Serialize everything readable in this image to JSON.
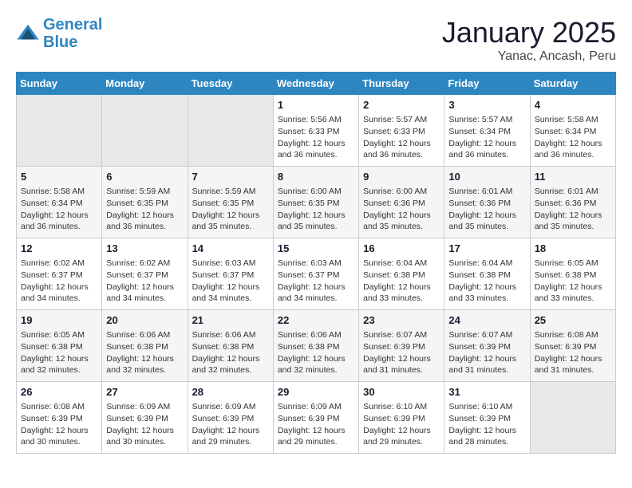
{
  "header": {
    "logo_line1": "General",
    "logo_line2": "Blue",
    "title": "January 2025",
    "subtitle": "Yanac, Ancash, Peru"
  },
  "weekdays": [
    "Sunday",
    "Monday",
    "Tuesday",
    "Wednesday",
    "Thursday",
    "Friday",
    "Saturday"
  ],
  "weeks": [
    [
      {
        "day": "",
        "info": ""
      },
      {
        "day": "",
        "info": ""
      },
      {
        "day": "",
        "info": ""
      },
      {
        "day": "1",
        "info": "Sunrise: 5:56 AM\nSunset: 6:33 PM\nDaylight: 12 hours\nand 36 minutes."
      },
      {
        "day": "2",
        "info": "Sunrise: 5:57 AM\nSunset: 6:33 PM\nDaylight: 12 hours\nand 36 minutes."
      },
      {
        "day": "3",
        "info": "Sunrise: 5:57 AM\nSunset: 6:34 PM\nDaylight: 12 hours\nand 36 minutes."
      },
      {
        "day": "4",
        "info": "Sunrise: 5:58 AM\nSunset: 6:34 PM\nDaylight: 12 hours\nand 36 minutes."
      }
    ],
    [
      {
        "day": "5",
        "info": "Sunrise: 5:58 AM\nSunset: 6:34 PM\nDaylight: 12 hours\nand 36 minutes."
      },
      {
        "day": "6",
        "info": "Sunrise: 5:59 AM\nSunset: 6:35 PM\nDaylight: 12 hours\nand 36 minutes."
      },
      {
        "day": "7",
        "info": "Sunrise: 5:59 AM\nSunset: 6:35 PM\nDaylight: 12 hours\nand 35 minutes."
      },
      {
        "day": "8",
        "info": "Sunrise: 6:00 AM\nSunset: 6:35 PM\nDaylight: 12 hours\nand 35 minutes."
      },
      {
        "day": "9",
        "info": "Sunrise: 6:00 AM\nSunset: 6:36 PM\nDaylight: 12 hours\nand 35 minutes."
      },
      {
        "day": "10",
        "info": "Sunrise: 6:01 AM\nSunset: 6:36 PM\nDaylight: 12 hours\nand 35 minutes."
      },
      {
        "day": "11",
        "info": "Sunrise: 6:01 AM\nSunset: 6:36 PM\nDaylight: 12 hours\nand 35 minutes."
      }
    ],
    [
      {
        "day": "12",
        "info": "Sunrise: 6:02 AM\nSunset: 6:37 PM\nDaylight: 12 hours\nand 34 minutes."
      },
      {
        "day": "13",
        "info": "Sunrise: 6:02 AM\nSunset: 6:37 PM\nDaylight: 12 hours\nand 34 minutes."
      },
      {
        "day": "14",
        "info": "Sunrise: 6:03 AM\nSunset: 6:37 PM\nDaylight: 12 hours\nand 34 minutes."
      },
      {
        "day": "15",
        "info": "Sunrise: 6:03 AM\nSunset: 6:37 PM\nDaylight: 12 hours\nand 34 minutes."
      },
      {
        "day": "16",
        "info": "Sunrise: 6:04 AM\nSunset: 6:38 PM\nDaylight: 12 hours\nand 33 minutes."
      },
      {
        "day": "17",
        "info": "Sunrise: 6:04 AM\nSunset: 6:38 PM\nDaylight: 12 hours\nand 33 minutes."
      },
      {
        "day": "18",
        "info": "Sunrise: 6:05 AM\nSunset: 6:38 PM\nDaylight: 12 hours\nand 33 minutes."
      }
    ],
    [
      {
        "day": "19",
        "info": "Sunrise: 6:05 AM\nSunset: 6:38 PM\nDaylight: 12 hours\nand 32 minutes."
      },
      {
        "day": "20",
        "info": "Sunrise: 6:06 AM\nSunset: 6:38 PM\nDaylight: 12 hours\nand 32 minutes."
      },
      {
        "day": "21",
        "info": "Sunrise: 6:06 AM\nSunset: 6:38 PM\nDaylight: 12 hours\nand 32 minutes."
      },
      {
        "day": "22",
        "info": "Sunrise: 6:06 AM\nSunset: 6:38 PM\nDaylight: 12 hours\nand 32 minutes."
      },
      {
        "day": "23",
        "info": "Sunrise: 6:07 AM\nSunset: 6:39 PM\nDaylight: 12 hours\nand 31 minutes."
      },
      {
        "day": "24",
        "info": "Sunrise: 6:07 AM\nSunset: 6:39 PM\nDaylight: 12 hours\nand 31 minutes."
      },
      {
        "day": "25",
        "info": "Sunrise: 6:08 AM\nSunset: 6:39 PM\nDaylight: 12 hours\nand 31 minutes."
      }
    ],
    [
      {
        "day": "26",
        "info": "Sunrise: 6:08 AM\nSunset: 6:39 PM\nDaylight: 12 hours\nand 30 minutes."
      },
      {
        "day": "27",
        "info": "Sunrise: 6:09 AM\nSunset: 6:39 PM\nDaylight: 12 hours\nand 30 minutes."
      },
      {
        "day": "28",
        "info": "Sunrise: 6:09 AM\nSunset: 6:39 PM\nDaylight: 12 hours\nand 29 minutes."
      },
      {
        "day": "29",
        "info": "Sunrise: 6:09 AM\nSunset: 6:39 PM\nDaylight: 12 hours\nand 29 minutes."
      },
      {
        "day": "30",
        "info": "Sunrise: 6:10 AM\nSunset: 6:39 PM\nDaylight: 12 hours\nand 29 minutes."
      },
      {
        "day": "31",
        "info": "Sunrise: 6:10 AM\nSunset: 6:39 PM\nDaylight: 12 hours\nand 28 minutes."
      },
      {
        "day": "",
        "info": ""
      }
    ]
  ]
}
